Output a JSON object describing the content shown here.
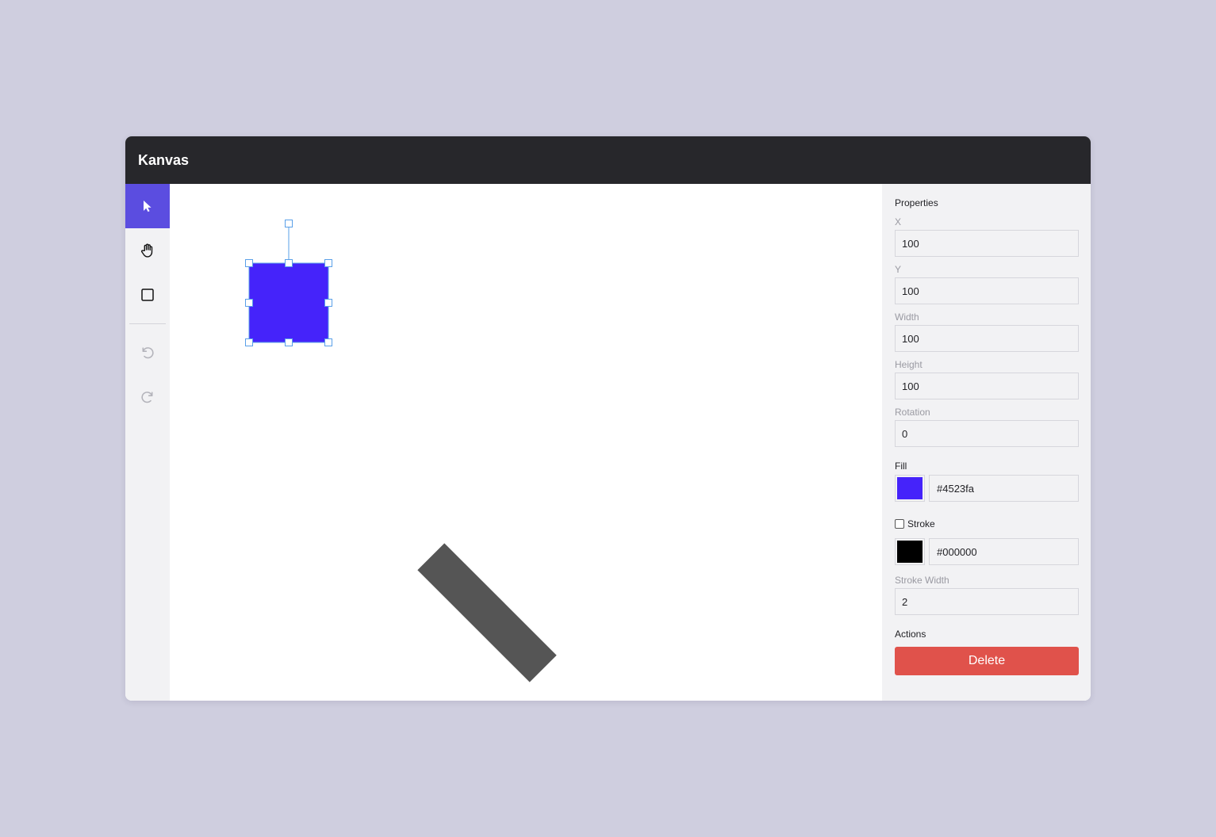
{
  "app": {
    "title": "Kanvas"
  },
  "toolbar": {
    "tools": [
      {
        "name": "select",
        "icon": "cursor-arrow-icon",
        "active": true
      },
      {
        "name": "hand",
        "icon": "hand-icon",
        "active": false
      },
      {
        "name": "rectangle",
        "icon": "square-icon",
        "active": false
      },
      {
        "name": "undo",
        "icon": "undo-icon",
        "enabled": false
      },
      {
        "name": "redo",
        "icon": "redo-icon",
        "enabled": false
      }
    ],
    "accent_color": "#5b4de0"
  },
  "canvas": {
    "shapes": [
      {
        "type": "rectangle",
        "fill": "#4523fa",
        "selected": true
      },
      {
        "type": "rectangle",
        "fill": "#555555",
        "selected": false
      }
    ],
    "selection_color": "#5aa0e8"
  },
  "properties": {
    "title": "Properties",
    "x": {
      "label": "X",
      "value": "100"
    },
    "y": {
      "label": "Y",
      "value": "100"
    },
    "width": {
      "label": "Width",
      "value": "100"
    },
    "height": {
      "label": "Height",
      "value": "100"
    },
    "rotation": {
      "label": "Rotation",
      "value": "0"
    },
    "fill": {
      "label": "Fill",
      "value": "#4523fa"
    },
    "stroke": {
      "label": "Stroke",
      "checked": false,
      "value": "#000000"
    },
    "stroke_width": {
      "label": "Stroke Width",
      "value": "2"
    },
    "actions": {
      "label": "Actions",
      "delete_label": "Delete",
      "delete_color": "#e0524b"
    }
  }
}
